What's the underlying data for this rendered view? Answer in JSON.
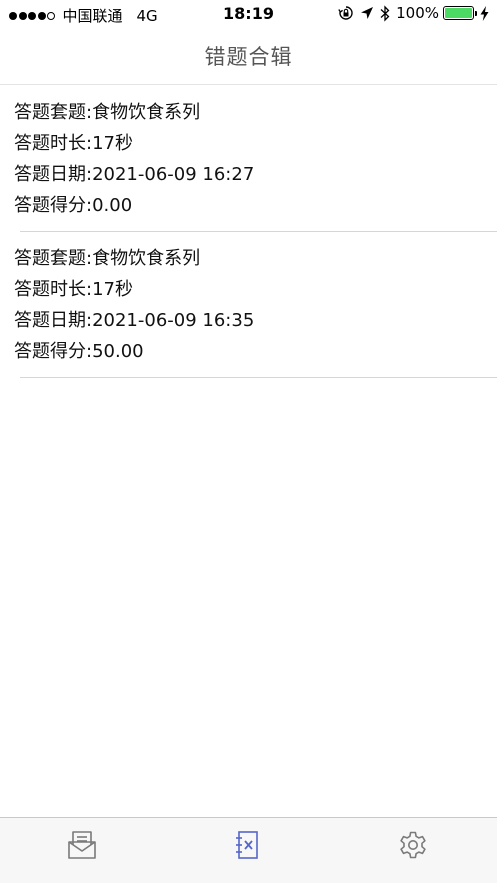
{
  "status_bar": {
    "carrier": "中国联通",
    "network": "4G",
    "time": "18:19",
    "battery": "100%",
    "battery_color": "#4cd964"
  },
  "nav": {
    "title": "错题合辑"
  },
  "records": [
    {
      "set": "答题套题:食物饮食系列",
      "duration": "答题时长:17秒",
      "date": "答题日期:2021-06-09 16:27",
      "score": "答题得分:0.00"
    },
    {
      "set": "答题套题:食物饮食系列",
      "duration": "答题时长:17秒",
      "date": "答题日期:2021-06-09 16:35",
      "score": "答题得分:50.00"
    }
  ],
  "tab_bar": {
    "tabs": [
      {
        "icon": "inbox-icon",
        "active": false
      },
      {
        "icon": "wrong-answers-icon",
        "active": true
      },
      {
        "icon": "gear-icon",
        "active": false
      }
    ],
    "active_color": "#5566c9",
    "inactive_color": "#7a7a7a"
  }
}
